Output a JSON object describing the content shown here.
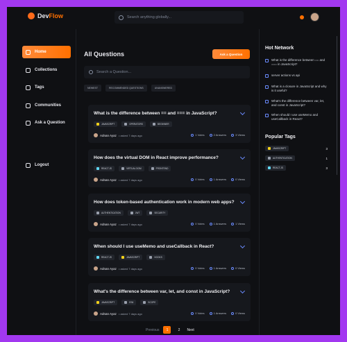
{
  "brand": {
    "name_part1": "Dev",
    "name_part2": "Flow",
    "accent": "#ff7000"
  },
  "global_search": {
    "placeholder": "Search anything globally..."
  },
  "sidebar": {
    "items": [
      {
        "label": "Home",
        "icon": "home-icon",
        "active": true
      },
      {
        "label": "Collections",
        "icon": "star-icon"
      },
      {
        "label": "Tags",
        "icon": "tag-icon"
      },
      {
        "label": "Communities",
        "icon": "users-icon"
      },
      {
        "label": "Ask a Question",
        "icon": "question-icon"
      }
    ],
    "logout": "Logout"
  },
  "main": {
    "title": "All Questions",
    "ask_button": "Ask a Question",
    "search_placeholder": "Search a Question...",
    "filters": [
      "NEWEST",
      "RECOMMENDED QUESTIONS",
      "UNANSWERED"
    ]
  },
  "questions": [
    {
      "title": "What is the difference between == and === in JavaScript?",
      "tags": [
        "JAVASCRIPT",
        "OPERATORS",
        "BEGINNER"
      ],
      "author": "Adnan Ayaz",
      "meta": "• asked 7 days ago",
      "votes": "1 Votes",
      "answers": "2 Answers",
      "views": "3 Views"
    },
    {
      "title": "How does the virtual DOM in React improve performance?",
      "tags": [
        "REACT.JS",
        "VIRTUAL DOM",
        "FRONTEND"
      ],
      "author": "Adnan Ayaz",
      "meta": "• asked 7 days ago",
      "votes": "0 Votes",
      "answers": "1 Answers",
      "views": "0 Views"
    },
    {
      "title": "How does token-based authentication work in modern web apps?",
      "tags": [
        "AUTHENTICATION",
        "JWT",
        "SECURITY"
      ],
      "author": "Adnan Ayaz",
      "meta": "• asked 7 days ago",
      "votes": "0 Votes",
      "answers": "1 Answers",
      "views": "1 Views"
    },
    {
      "title": "When should I use useMemo and useCallback in React?",
      "tags": [
        "REACT.JS",
        "JAVASCRIPT",
        "HOOKS"
      ],
      "author": "Adnan Ayaz",
      "meta": "• asked 7 days ago",
      "votes": "0 Votes",
      "answers": "1 Answers",
      "views": "0 Views"
    },
    {
      "title": "What's the difference between var, let, and const in JavaScript?",
      "tags": [
        "JAVASCRIPT",
        "ES6",
        "SCOPE"
      ],
      "author": "Adnan Ayaz",
      "meta": "• asked 7 days ago",
      "votes": "0 Votes",
      "answers": "1 Answers",
      "views": "0 Views"
    }
  ],
  "pagination": {
    "prev": "Previous",
    "pages": [
      "1",
      "2"
    ],
    "current": "1",
    "next": "Next"
  },
  "hot_network": {
    "title": "Hot Network",
    "items": [
      "What is the difference between == and === in JavaScript?",
      "server actions vs api",
      "What is a closure in JavaScript and why is it useful?",
      "What's the difference between var, let, and const in JavaScript?",
      "When should I use useMemo and useCallback in React?"
    ]
  },
  "popular_tags": {
    "title": "Popular Tags",
    "items": [
      {
        "name": "JAVASCRIPT",
        "count": "3"
      },
      {
        "name": "AUTHENTICATION",
        "count": "1"
      },
      {
        "name": "REACT.JS",
        "count": "3"
      }
    ]
  }
}
